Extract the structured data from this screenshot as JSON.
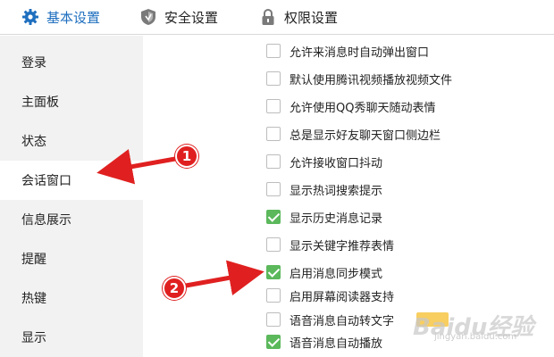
{
  "top_tabs": [
    {
      "label": "基本设置",
      "icon": "gear-icon",
      "active": true
    },
    {
      "label": "安全设置",
      "icon": "shield-icon",
      "active": false
    },
    {
      "label": "权限设置",
      "icon": "lock-icon",
      "active": false
    }
  ],
  "sidebar": {
    "items": [
      {
        "label": "登录"
      },
      {
        "label": "主面板"
      },
      {
        "label": "状态"
      },
      {
        "label": "会话窗口"
      },
      {
        "label": "信息展示"
      },
      {
        "label": "提醒"
      },
      {
        "label": "热键"
      },
      {
        "label": "显示"
      }
    ],
    "active_index": 3
  },
  "options": [
    {
      "label": "允许来消息时自动弹出窗口",
      "checked": false
    },
    {
      "label": "默认使用腾讯视频播放视频文件",
      "checked": false
    },
    {
      "label": "允许使用QQ秀聊天随动表情",
      "checked": false
    },
    {
      "label": "总是显示好友聊天窗口侧边栏",
      "checked": false
    },
    {
      "label": "允许接收窗口抖动",
      "checked": false
    },
    {
      "label": "显示热词搜索提示",
      "checked": false
    },
    {
      "label": "显示历史消息记录",
      "checked": true
    },
    {
      "label": "显示关键字推荐表情",
      "checked": false
    },
    {
      "label": "启用消息同步模式",
      "checked": true
    },
    {
      "label": "启用屏幕阅读器支持",
      "checked": false
    },
    {
      "label": "语音消息自动转文字",
      "checked": false
    },
    {
      "label": "语音消息自动播放",
      "checked": true
    }
  ],
  "annotations": {
    "badge_1": "1",
    "badge_2": "2"
  },
  "watermark": {
    "text": "Baidu经验",
    "sub": "jingyan.baidu.com"
  },
  "colors": {
    "accent": "#1f6fbf",
    "checkbox_checked": "#5bb85b",
    "annotation_red": "#e02020",
    "sidebar_bg": "#f2f2f2"
  }
}
